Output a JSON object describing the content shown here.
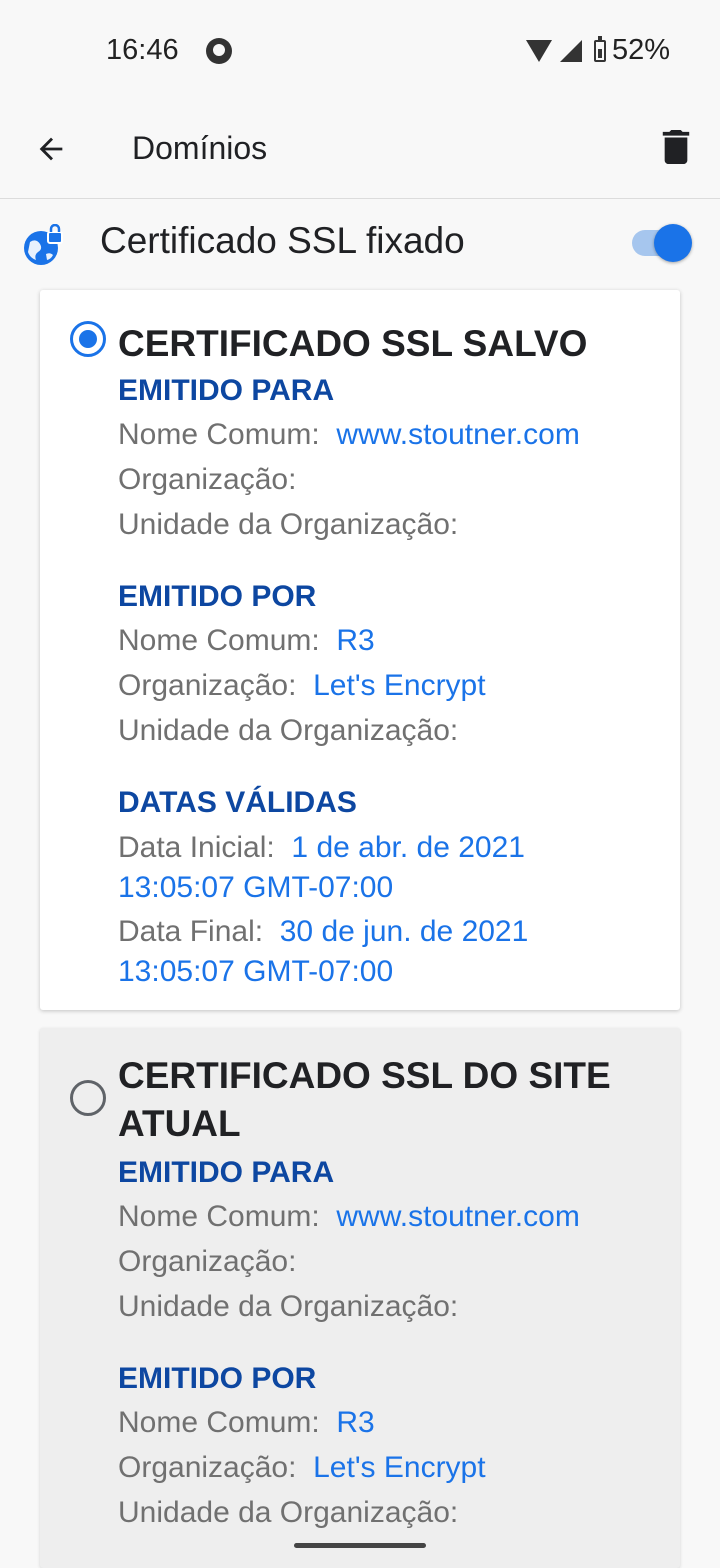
{
  "status_bar": {
    "time": "16:46",
    "battery": "52%"
  },
  "app_bar": {
    "title": "Domínios"
  },
  "pinned": {
    "label": "Certificado SSL fixado",
    "enabled": true
  },
  "colors": {
    "accent": "#1a73e8",
    "section_heading": "#0d47a1",
    "label_gray": "#707070"
  },
  "saved_cert": {
    "title": "CERTIFICADO SSL SALVO",
    "selected": true,
    "issued_to": {
      "heading": "EMITIDO PARA",
      "common_name_label": "Nome Comum:",
      "common_name": "www.stoutner.com",
      "organization_label": "Organização:",
      "organization": "",
      "unit_label": "Unidade da Organização:",
      "unit": ""
    },
    "issued_by": {
      "heading": "EMITIDO POR",
      "common_name_label": "Nome Comum:",
      "common_name": "R3",
      "organization_label": "Organização:",
      "organization": "Let's Encrypt",
      "unit_label": "Unidade da Organização:",
      "unit": ""
    },
    "valid_dates": {
      "heading": "DATAS VÁLIDAS",
      "start_label": "Data Inicial:",
      "start": "1 de abr. de 2021 13:05:07 GMT-07:00",
      "end_label": "Data Final:",
      "end": "30 de jun. de 2021 13:05:07 GMT-07:00"
    }
  },
  "current_cert": {
    "title": "CERTIFICADO SSL DO SITE ATUAL",
    "selected": false,
    "issued_to": {
      "heading": "EMITIDO PARA",
      "common_name_label": "Nome Comum:",
      "common_name": "www.stoutner.com",
      "organization_label": "Organização:",
      "organization": "",
      "unit_label": "Unidade da Organização:",
      "unit": ""
    },
    "issued_by": {
      "heading": "EMITIDO POR",
      "common_name_label": "Nome Comum:",
      "common_name": "R3",
      "organization_label": "Organização:",
      "organization": "Let's Encrypt",
      "unit_label": "Unidade da Organização:",
      "unit": ""
    }
  }
}
